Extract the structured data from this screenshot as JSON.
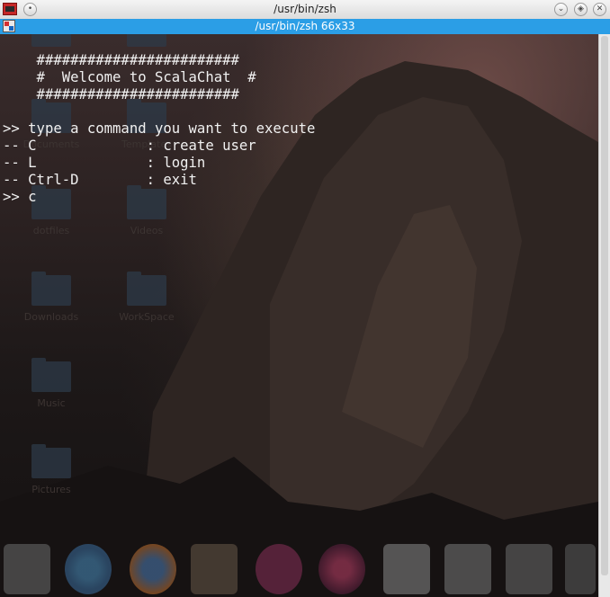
{
  "window": {
    "title": "/usr/bin/zsh",
    "buttons": [
      "minimize",
      "maximize",
      "close"
    ]
  },
  "tab": {
    "title": "/usr/bin/zsh 66x33"
  },
  "terminal": {
    "lines": [
      "    ########################",
      "    #  Welcome to ScalaChat  #",
      "    ########################",
      "",
      ">> type a command you want to execute",
      "-- C             : create user",
      "-- L             : login",
      "-- Ctrl-D        : exit",
      ">> c"
    ]
  },
  "desktop": {
    "icons": [
      "Documents",
      "Templates",
      "dotfiles",
      "Videos",
      "Downloads",
      "WorkSpace",
      "Music",
      "Pictures"
    ]
  },
  "dock": {
    "items": [
      "file-manager-icon",
      "chrome-icon",
      "firefox-icon",
      "map-icon",
      "music-player-icon",
      "eye-icon",
      "document-icon",
      "editor-icon",
      "screen-icon",
      "tools-icon"
    ]
  }
}
